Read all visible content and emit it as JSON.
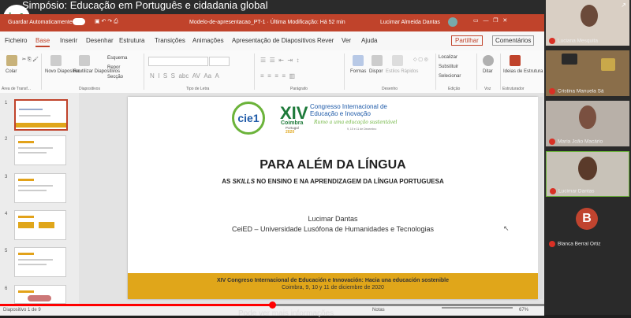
{
  "video": {
    "title": "Simpósio: Educação em Português e cidadania global",
    "logo_text": "ie1"
  },
  "ppt": {
    "autosave": "Guardar Automaticamente",
    "doc_title": "Modelo-de-apresentacao_PT-1 · Última Modificação: Há 52 min",
    "user": "Lucimar Almeida Dantas",
    "tabs": [
      "Ficheiro",
      "Base",
      "Inserir",
      "Desenhar",
      "Estrutura",
      "Transições",
      "Animações",
      "Apresentação de Diapositivos",
      "Rever",
      "Ver",
      "Ajuda"
    ],
    "share": "Partilhar",
    "comments": "Comentários",
    "ribbon": {
      "paste": "Colar",
      "new_slide": "Novo Diapositivo",
      "reuse": "Reutilizar Diapositivos",
      "layout": "Esquema",
      "reset": "Repor",
      "section": "Secção",
      "font_box": "",
      "shapes": "Formas",
      "arrange": "Dispor",
      "quick_styles": "Estilos Rápidos",
      "find": "Localizar",
      "replace": "Substituir",
      "select": "Selecionar",
      "dictate": "Ditar",
      "design_ideas": "Ideias de Estrutura",
      "groups": [
        "Área de Transf...",
        "Diapositivos",
        "Tipo de Letra",
        "Parágrafo",
        "Desenho",
        "Edição",
        "Voz",
        "Estruturador"
      ]
    },
    "thumbs": [
      "1",
      "2",
      "3",
      "4",
      "5",
      "6"
    ],
    "status": {
      "slide": "Diapositivo 1 de 9",
      "notes": "Notas",
      "zoom": "67%"
    }
  },
  "slide": {
    "xiv": "XIV",
    "coimbra": "Coimbra",
    "portugal": "Portugal",
    "year": "2020",
    "congress_line1": "Congresso Internacional de",
    "congress_line2": "Educação e Inovação",
    "tagline": "Rumo a uma educação sustentável",
    "dates": "9, 10 e 11 de Dezembro",
    "logo": "cie1",
    "title": "PARA ALÉM DA LÍNGUA",
    "subtitle_pre": "AS ",
    "subtitle_em": "SKILLS",
    "subtitle_post": " NO ENSINO E NA APRENDIZAGEM DA LÍNGUA PORTUGUESA",
    "author": "Lucimar Dantas",
    "affiliation": "CeiED – Universidade Lusófona de Humanidades e Tecnologias",
    "footer1": "XIV Congreso Internacional de Educación e Innovación: Hacia una educación sostenible",
    "footer2": "Coimbra, 9, 10 y 11 de diciembre de 2020"
  },
  "participants": [
    {
      "name": "Luciana Mesquita"
    },
    {
      "name": "Cristina Manuela Sá"
    },
    {
      "name": "Maria João Macário"
    },
    {
      "name": "Lucimar Dantas"
    },
    {
      "name": "Blanca Berral Ortiz",
      "initial": "B"
    }
  ],
  "colors": {
    "ppt_accent": "#c0432b",
    "footer_band": "#e0a61a",
    "green": "#1c7a3a"
  },
  "player": {
    "caption": "Pode ver mais informações",
    "progress_fraction": 0.5
  }
}
